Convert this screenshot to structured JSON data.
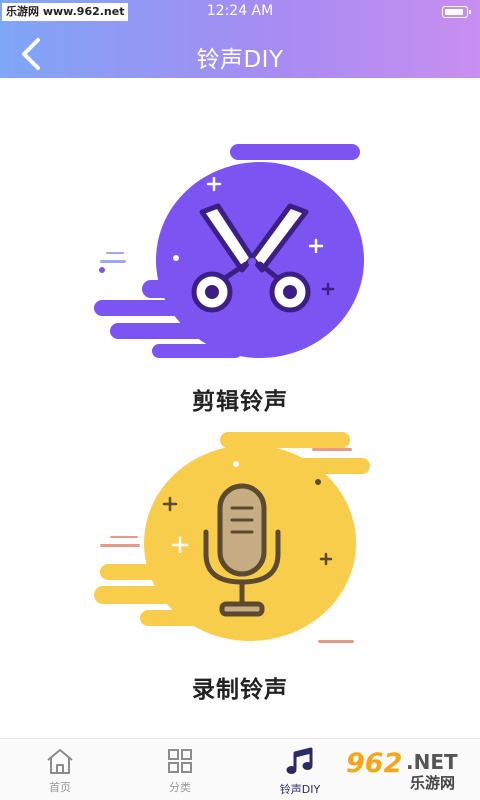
{
  "status_bar": {
    "watermark": "乐游网 www.962.net",
    "time": "12:24 AM",
    "battery_level": 0.9
  },
  "header": {
    "title": "铃声DIY",
    "back_icon": "chevron-left-icon"
  },
  "options": [
    {
      "label": "剪辑铃声",
      "icon": "scissors-icon",
      "color": "#7c54f2"
    },
    {
      "label": "录制铃声",
      "icon": "microphone-icon",
      "color": "#f9cd4c"
    }
  ],
  "tabbar": {
    "tabs": [
      {
        "label": "首页",
        "icon": "home-icon",
        "active": false
      },
      {
        "label": "分类",
        "icon": "grid-icon",
        "active": false
      },
      {
        "label": "铃声DIY",
        "icon": "music-note-icon",
        "active": true
      }
    ]
  },
  "corner_logo": {
    "mark": "962",
    "suffix": ".NET",
    "subtitle": "乐游网"
  },
  "colors": {
    "header_gradient": [
      "#7fa6f7",
      "#c88ef0"
    ],
    "purple_blob": "#7c54f2",
    "yellow_blob": "#f9cd4c",
    "active_tab": "#2b2b63"
  }
}
